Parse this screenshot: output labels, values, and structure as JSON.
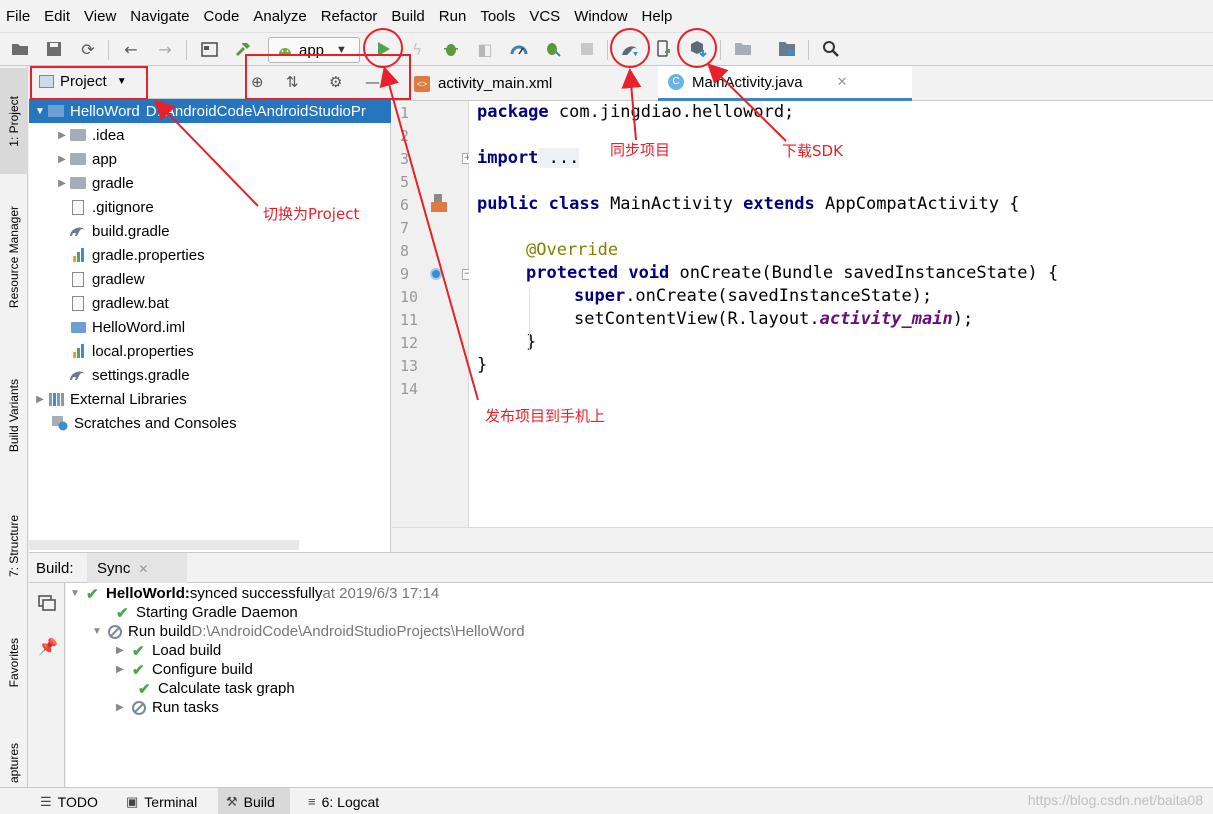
{
  "menu": [
    "File",
    "Edit",
    "View",
    "Navigate",
    "Code",
    "Analyze",
    "Refactor",
    "Build",
    "Run",
    "Tools",
    "VCS",
    "Window",
    "Help"
  ],
  "toolbar": {
    "run_config": "app",
    "icons": [
      "open-folder-icon",
      "save-icon",
      "sync-icon",
      "back-icon",
      "forward-icon",
      "frame-icon",
      "hammer-icon",
      "android-icon",
      "run-icon",
      "lightning-icon",
      "debug-icon",
      "profile-icon",
      "gauge-icon",
      "attach-debugger-icon",
      "stop-icon",
      "gradle-sync-icon",
      "device-manager-icon",
      "sdk-download-icon",
      "folder-icon",
      "project-structure-icon",
      "search-icon"
    ]
  },
  "left_strip": {
    "tabs": [
      "1: Project",
      "Resource Manager",
      "Build Variants",
      "7: Structure",
      "Favorites",
      "aptures"
    ]
  },
  "project_panel": {
    "title": "Project",
    "root": {
      "name": "HelloWord",
      "path": "D:\\AndroidCode\\AndroidStudioPr"
    },
    "items": [
      ".idea",
      "app",
      "gradle",
      ".gitignore",
      "build.gradle",
      "gradle.properties",
      "gradlew",
      "gradlew.bat",
      "HelloWord.iml",
      "local.properties",
      "settings.gradle"
    ],
    "external": "External Libraries",
    "scratches": "Scratches and Consoles"
  },
  "editor": {
    "tabs": [
      {
        "label": "activity_main.xml",
        "active": false
      },
      {
        "label": "MainActivity.java",
        "active": true
      }
    ],
    "line_numbers": [
      "1",
      "2",
      "3",
      "5",
      "6",
      "7",
      "8",
      "9",
      "10",
      "11",
      "12",
      "13",
      "14"
    ],
    "code": {
      "l1_kw": "package",
      "l1_rest": " com.jingdiao.helloword;",
      "l3_kw": "import",
      "l3_rest": " ...",
      "l6_kw1": "public class",
      "l6_name": " MainActivity ",
      "l6_kw2": "extends",
      "l6_rest": " AppCompatActivity {",
      "l8_ann": "@Override",
      "l9_kw": "protected void",
      "l9_rest": " onCreate(Bundle savedInstanceState) {",
      "l10_kw": "super",
      "l10_rest": ".onCreate(savedInstanceState);",
      "l11_pre": "setContentView(R.layout.",
      "l11_field": "activity_main",
      "l11_post": ");",
      "l12": "}",
      "l13": "}"
    }
  },
  "build": {
    "label": "Build:",
    "tab": "Sync",
    "rows": {
      "r1_bold": "HelloWorld:",
      "r1_text": " synced successfully",
      "r1_time": " at 2019/6/3 17:14",
      "r2": "Starting Gradle Daemon",
      "r3": "Run build",
      "r3_path": " D:\\AndroidCode\\AndroidStudioProjects\\HelloWord",
      "r4": "Load build",
      "r5": "Configure build",
      "r6": "Calculate task graph",
      "r7": "Run tasks"
    }
  },
  "statusbar": {
    "todo": "TODO",
    "terminal": "Terminal",
    "build": "Build",
    "logcat": "6: Logcat",
    "watermark": "https://blog.csdn.net/baita08"
  },
  "annotations": {
    "switch_project": "切换为Project",
    "sync_project": "同步项目",
    "download_sdk": "下载SDK",
    "deploy": "发布项目到手机上"
  },
  "colors": {
    "annotation": "#e8202a",
    "selection": "#2675bf",
    "success": "#4ca64c",
    "keyword": "#000080"
  }
}
